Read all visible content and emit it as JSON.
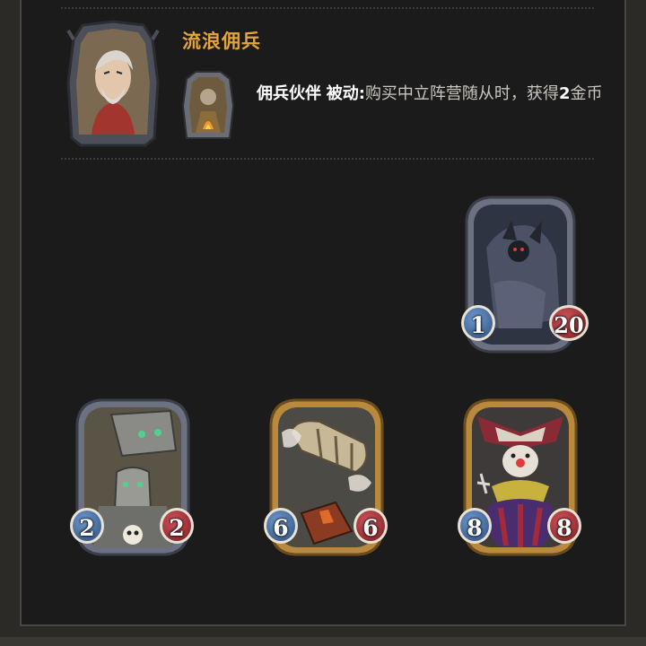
{
  "hero": {
    "name": "流浪佣兵",
    "power": {
      "label": "佣兵伙伴",
      "type": "被动",
      "separator": ":",
      "description": "购买中立阵营随从时，获得",
      "highlight": "2",
      "suffix": "金币"
    }
  },
  "cards": [
    {
      "id": "dragon",
      "attack": "1",
      "health": "20",
      "frame": "silver",
      "icon": "dragon-icon"
    },
    {
      "id": "robot",
      "attack": "2",
      "health": "2",
      "frame": "silver",
      "icon": "robot-icon"
    },
    {
      "id": "airship",
      "attack": "6",
      "health": "6",
      "frame": "gold",
      "icon": "airship-icon"
    },
    {
      "id": "clown",
      "attack": "8",
      "health": "8",
      "frame": "gold",
      "icon": "clown-icon"
    }
  ],
  "colors": {
    "hero_name": "#e3a43a",
    "attack": "#3e6aa8",
    "health": "#a8323a",
    "silver_frame": "#5c6270",
    "gold_frame": "#b98a3e"
  }
}
